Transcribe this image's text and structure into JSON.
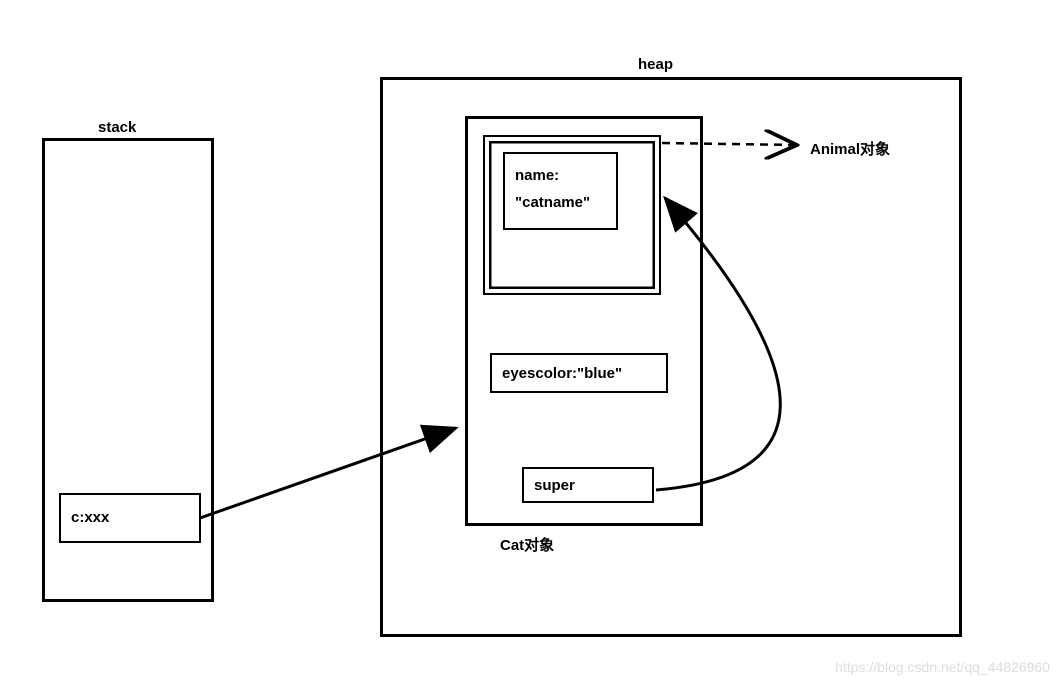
{
  "stack": {
    "title": "stack",
    "variable": "c:xxx"
  },
  "heap": {
    "title": "heap",
    "animal_label": "Animal对象",
    "cat_label": "Cat对象",
    "cat_object": {
      "name_field": "name:\n\"catname\"",
      "eyescolor_field": "eyescolor:\"blue\"",
      "super_field": "super"
    }
  },
  "watermark": "https://blog.csdn.net/qq_44826960"
}
